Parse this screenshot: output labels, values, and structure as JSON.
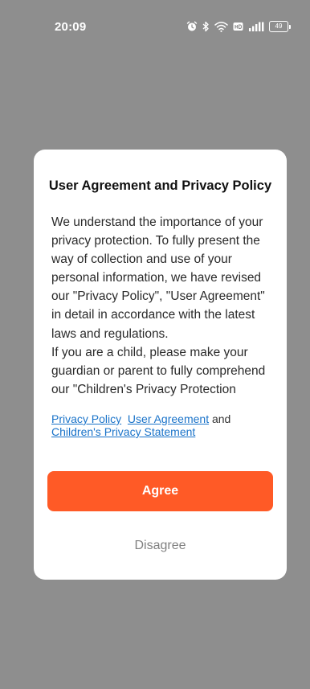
{
  "status_bar": {
    "time": "20:09",
    "battery_level": "49",
    "icons": [
      "alarm-icon",
      "bluetooth-icon",
      "wifi-icon",
      "hd-icon",
      "5g-signal-icon",
      "battery-icon"
    ]
  },
  "dialog": {
    "title": "User Agreement and Privacy Policy",
    "body": [
      "We understand the importance of your privacy protection. To fully present the way of collection and use of your personal information, we have revised our \"Privacy Policy\", \"User Agreement\" in detail in accordance with the latest laws and regulations.",
      "If you are a child, please make your guardian or parent to fully comprehend our \"Children's Privacy Protection"
    ],
    "links": {
      "privacy_policy": "Privacy Policy",
      "user_agreement": "User Agreement",
      "connector": "and",
      "childrens_privacy": "Children's Privacy Statement"
    },
    "agree_label": "Agree",
    "disagree_label": "Disagree"
  },
  "colors": {
    "overlay": "#8e8e8e",
    "accent": "#ff5a26",
    "link": "#1a73c9"
  }
}
